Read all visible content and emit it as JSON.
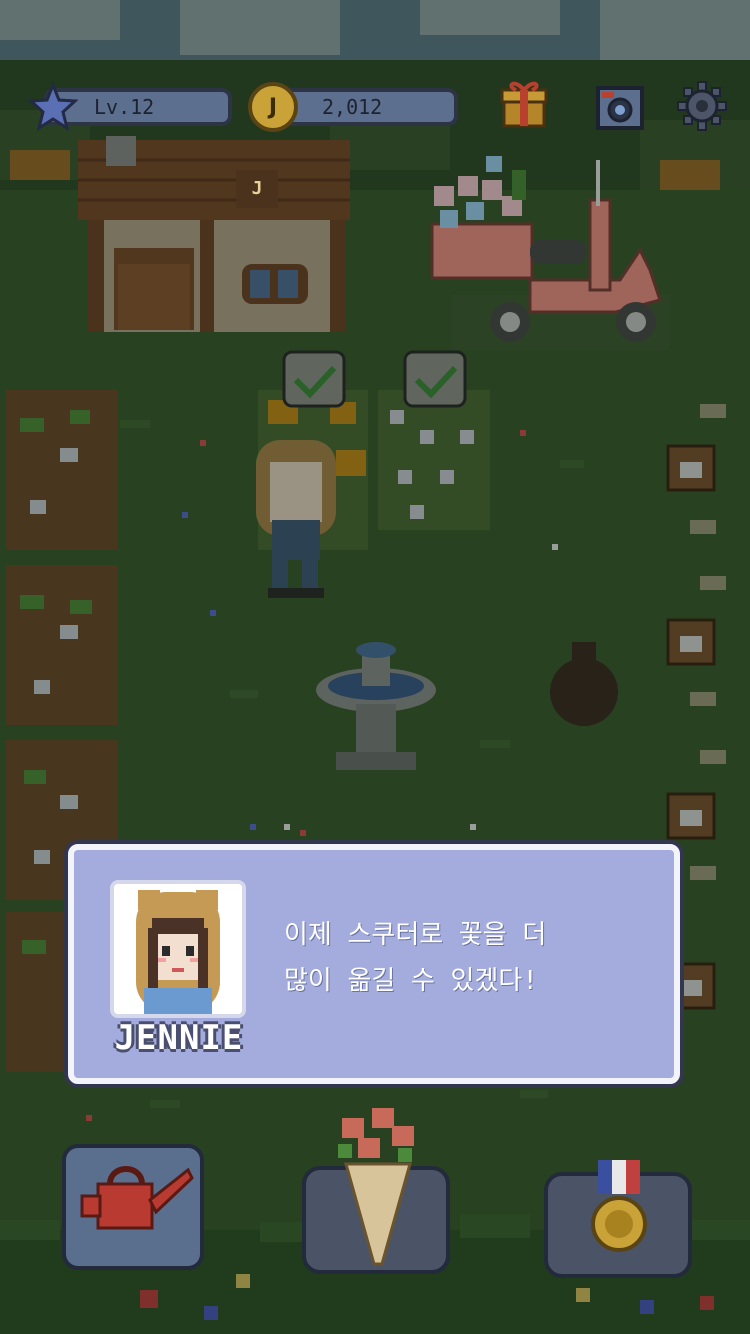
{
  "hud": {
    "level_label": "Lv.12",
    "coin_symbol": "J",
    "coin_amount": "2,012",
    "icons": [
      "star-icon",
      "coin-icon",
      "gift-box-icon",
      "camera-icon",
      "gear-icon"
    ]
  },
  "shop_sign": "J",
  "dialog": {
    "speaker": "JENNIE",
    "line1": "이제 스쿠터로 꽃을 더",
    "line2": "많이 옮길 수 있겠다!"
  },
  "bottom_bar": {
    "icons": [
      "watering-can-icon",
      "flower-bouquet-icon",
      "medal-icon"
    ]
  },
  "colors": {
    "dialog_bg": "#a3acdc",
    "dialog_border": "#f2f3fb",
    "hud_pill": "#5d6f8e",
    "coin": "#c9a238",
    "scooter": "#f08f86"
  }
}
